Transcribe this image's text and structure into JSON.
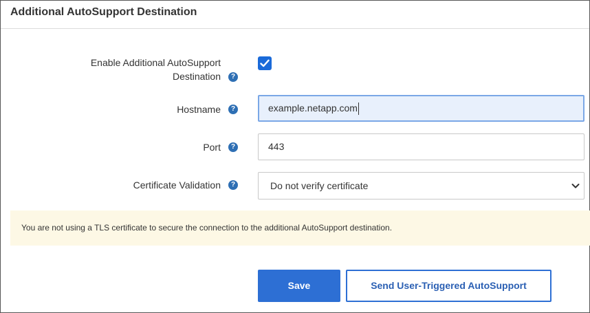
{
  "section": {
    "title": "Additional AutoSupport Destination"
  },
  "form": {
    "enable": {
      "label_line1": "Enable Additional AutoSupport",
      "label_line2": "Destination",
      "checked": true
    },
    "hostname": {
      "label": "Hostname",
      "value": "example.netapp.com"
    },
    "port": {
      "label": "Port",
      "value": "443"
    },
    "cert": {
      "label": "Certificate Validation",
      "selected": "Do not verify certificate"
    },
    "help_icon_glyph": "?"
  },
  "alert": {
    "message": "You are not using a TLS certificate to secure the connection to the additional AutoSupport destination."
  },
  "actions": {
    "save_label": "Save",
    "send_label": "Send User-Triggered AutoSupport"
  },
  "colors": {
    "primary": "#2d6fd4",
    "help_icon": "#2e6fb4",
    "alert_bg": "#fdf8e5",
    "focus_bg": "#e8f0fc"
  },
  "icons": {
    "help": "question-circle-icon",
    "check": "checkmark-icon",
    "chevron": "chevron-down-icon"
  }
}
